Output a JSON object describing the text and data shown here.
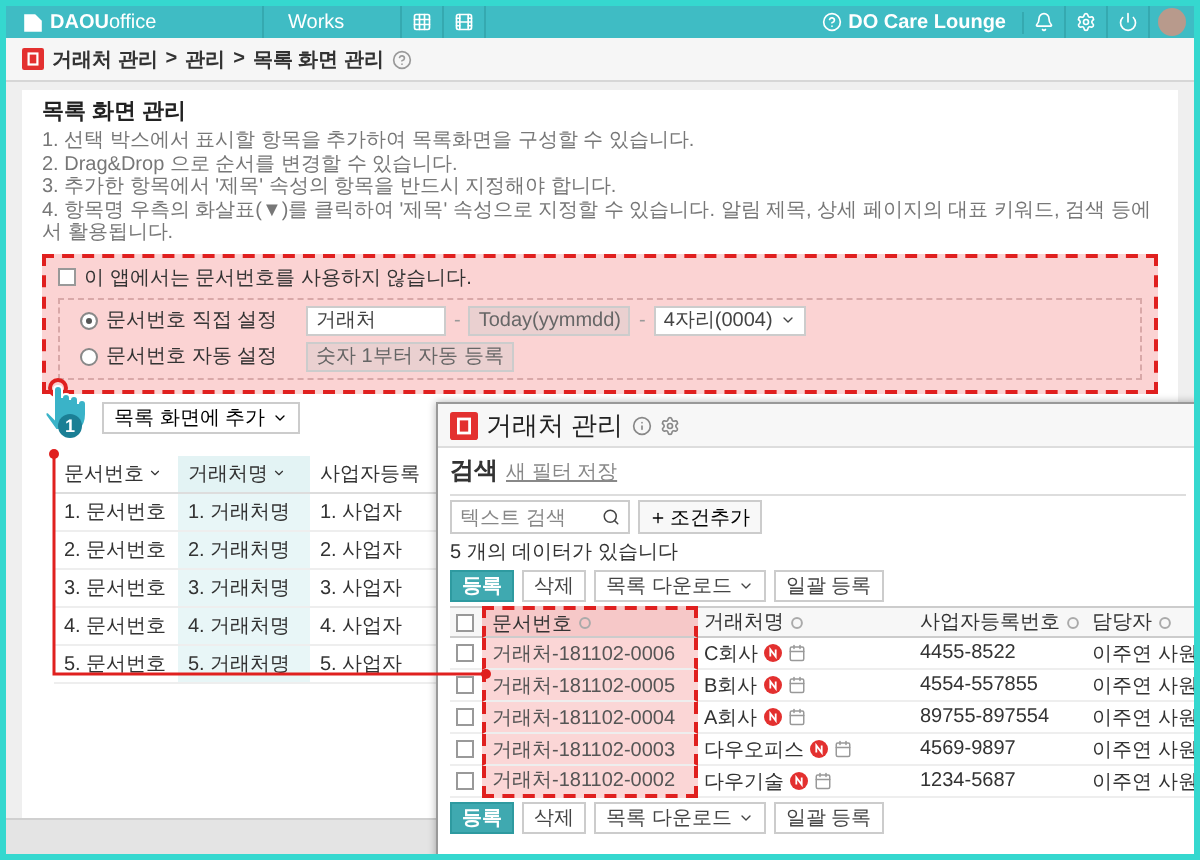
{
  "top_bar": {
    "logo_brand": "DAOU",
    "logo_suffix": "office",
    "menu": "Works",
    "link": "DO Care Lounge"
  },
  "breadcrumb": {
    "items": [
      "거래처 관리",
      "관리",
      "목록 화면 관리"
    ],
    "separator": ">"
  },
  "panel": {
    "title": "목록 화면 관리",
    "instructions": [
      "1. 선택 박스에서 표시할 항목을 추가하여 목록화면을 구성할 수 있습니다.",
      "2. Drag&Drop 으로 순서를 변경할 수 있습니다.",
      "3. 추가한 항목에서 '제목' 속성의 항목을 반드시 지정해야 합니다.",
      "4. 항목명 우측의 화살표(▼)를 클릭하여 '제목' 속성으로 지정할 수 있습니다. 알림 제목, 상세 페이지의 대표 키워드, 검색 등에서 활용됩니다."
    ]
  },
  "doc_number": {
    "highlighted": true,
    "disable_option": {
      "label": "이 앱에서는 문서번호를 사용하지 않습니다.",
      "checked": false
    },
    "modes": [
      {
        "label": "문서번호 직접 설정",
        "selected": true,
        "fields": [
          {
            "kind": "input",
            "value": "거래처",
            "disabled": false
          },
          {
            "kind": "dash",
            "text": "-"
          },
          {
            "kind": "input",
            "value": "Today(yymmdd)",
            "disabled": true
          },
          {
            "kind": "dash",
            "text": "-"
          },
          {
            "kind": "select",
            "value": "4자리(0004)"
          }
        ]
      },
      {
        "label": "문서번호 자동 설정",
        "selected": false,
        "fields": [
          {
            "kind": "input",
            "value": "숫자 1부터 자동 등록",
            "disabled": true
          }
        ]
      }
    ]
  },
  "step_marker": {
    "label": "1"
  },
  "add_button": {
    "label": "목록 화면에 추가"
  },
  "list_table": {
    "columns": [
      {
        "label": "문서번호",
        "highlighted": false
      },
      {
        "label": "거래처명",
        "highlighted": true
      },
      {
        "label": "사업자등록",
        "highlighted": false
      }
    ],
    "rows": [
      [
        "1. 문서번호",
        "1. 거래처명",
        "1. 사업자"
      ],
      [
        "2. 문서번호",
        "2. 거래처명",
        "2. 사업자"
      ],
      [
        "3. 문서번호",
        "3. 거래처명",
        "3. 사업자"
      ],
      [
        "4. 문서번호",
        "4. 거래처명",
        "4. 사업자"
      ],
      [
        "5. 문서번호",
        "5. 거래처명",
        "5. 사업자"
      ]
    ]
  },
  "popup": {
    "title": "거래처 관리",
    "search_title": "검색",
    "save_filter": "새 필터 저장",
    "search_placeholder": "텍스트 검색",
    "add_condition": "조건추가",
    "count": "5 개의 데이터가 있습니다",
    "toolbar_top": [
      {
        "kind": "primary",
        "label": "등록"
      },
      {
        "kind": "plain",
        "label": "삭제"
      },
      {
        "kind": "dropdown",
        "label": "목록 다운로드"
      },
      {
        "kind": "plain",
        "label": "일괄 등록"
      }
    ],
    "select_all": {
      "checked": false
    },
    "columns": [
      {
        "label": "문서번호",
        "highlighted": true
      },
      {
        "label": "거래처명",
        "highlighted": false
      },
      {
        "label": "사업자등록번호",
        "highlighted": false
      },
      {
        "label": "담당자",
        "highlighted": false
      }
    ],
    "rows": [
      {
        "checked": false,
        "doc_no": "거래처-181102-0006",
        "name": "C회사",
        "new": true,
        "biz_no": "4455-8522",
        "manager": "이주연 사원"
      },
      {
        "checked": false,
        "doc_no": "거래처-181102-0005",
        "name": "B회사",
        "new": true,
        "biz_no": "4554-557855",
        "manager": "이주연 사원"
      },
      {
        "checked": false,
        "doc_no": "거래처-181102-0004",
        "name": "A회사",
        "new": true,
        "biz_no": "89755-897554",
        "manager": "이주연 사원"
      },
      {
        "checked": false,
        "doc_no": "거래처-181102-0003",
        "name": "다우오피스",
        "new": true,
        "biz_no": "4569-9897",
        "manager": "이주연 사원"
      },
      {
        "checked": false,
        "doc_no": "거래처-181102-0002",
        "name": "다우기술",
        "new": true,
        "biz_no": "1234-5687",
        "manager": "이주연 사원"
      }
    ],
    "toolbar_bottom": [
      {
        "kind": "primary",
        "label": "등록"
      },
      {
        "kind": "plain",
        "label": "삭제"
      },
      {
        "kind": "dropdown",
        "label": "목록 다운로드"
      },
      {
        "kind": "plain",
        "label": "일괄 등록"
      }
    ]
  }
}
